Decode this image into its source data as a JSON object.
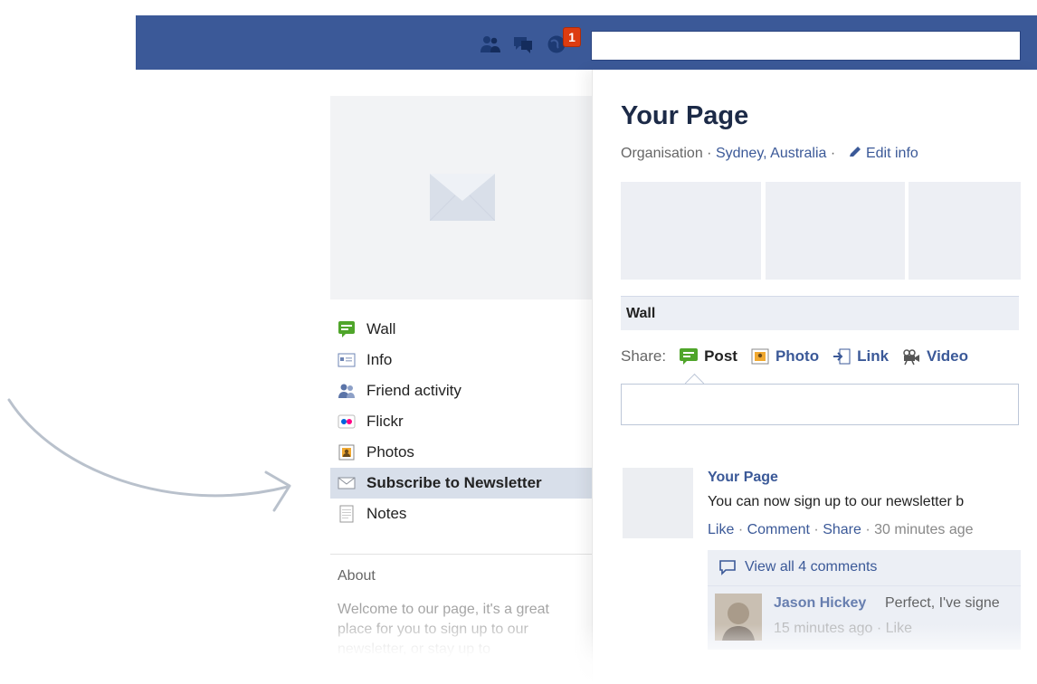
{
  "topbar": {
    "icons": [
      "friends-icon",
      "messages-icon",
      "notifications-icon"
    ],
    "notification_count": "1",
    "search_value": "",
    "brand_color": "#3b5998"
  },
  "left_nav": {
    "items": [
      {
        "label": "Wall",
        "icon": "wall-icon"
      },
      {
        "label": "Info",
        "icon": "info-icon"
      },
      {
        "label": "Friend activity",
        "icon": "friends-icon"
      },
      {
        "label": "Flickr",
        "icon": "flickr-icon"
      },
      {
        "label": "Photos",
        "icon": "photos-icon"
      },
      {
        "label": "Subscribe to Newsletter",
        "icon": "envelope-icon",
        "active": true
      },
      {
        "label": "Notes",
        "icon": "notes-icon"
      }
    ]
  },
  "about": {
    "heading": "About",
    "text": "Welcome to our page, it's a great place for you to sign up to our newsletter, or stay up to"
  },
  "page": {
    "title": "Your Page",
    "category": "Organisation",
    "location": "Sydney, Australia",
    "edit_info": "Edit info"
  },
  "wall": {
    "heading": "Wall",
    "share_label": "Share:",
    "share_options": [
      "Post",
      "Photo",
      "Link",
      "Video"
    ],
    "composer_value": ""
  },
  "post": {
    "author": "Your Page",
    "text": "You can now sign up to our newsletter b",
    "actions": {
      "like": "Like",
      "comment": "Comment",
      "share": "Share",
      "time": "30 minutes age"
    },
    "view_comments": "View all 4 comments",
    "comment": {
      "name": "Jason Hickey",
      "text": "Perfect, I've signe",
      "time": "15 minutes ago",
      "like": "Like"
    }
  }
}
